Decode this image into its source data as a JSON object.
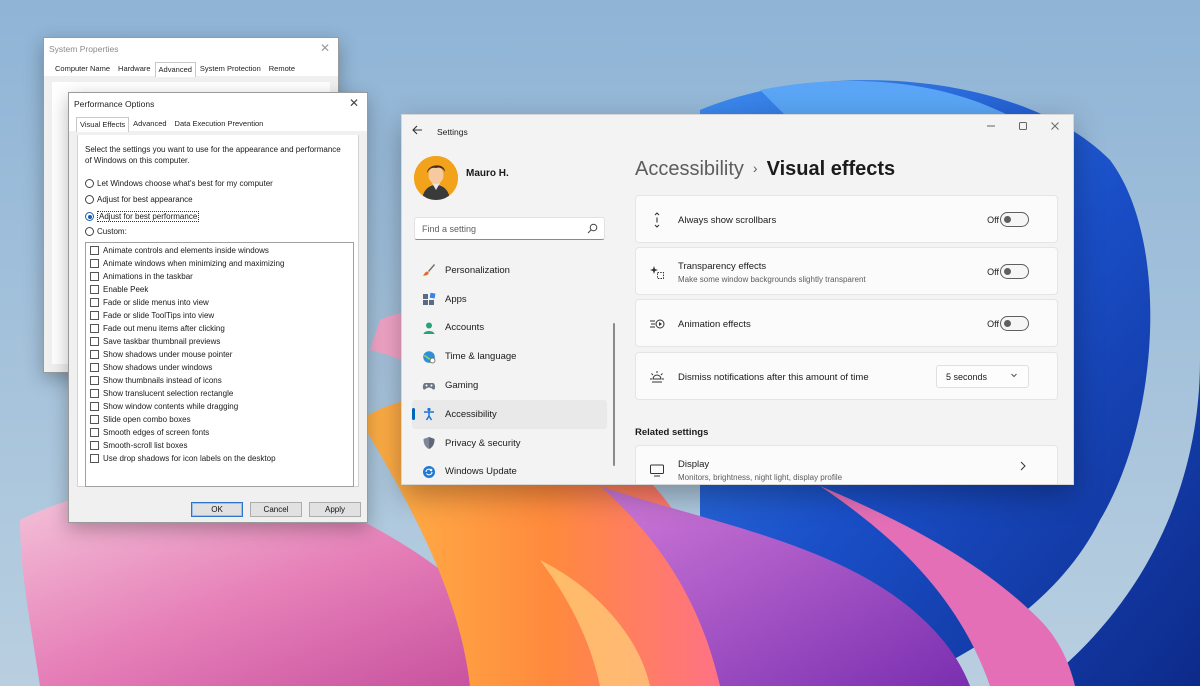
{
  "system_properties": {
    "title": "System Properties",
    "tabs": [
      "Computer Name",
      "Hardware",
      "Advanced",
      "System Protection",
      "Remote"
    ],
    "active_tab": "Advanced"
  },
  "performance_options": {
    "title": "Performance Options",
    "tabs": [
      "Visual Effects",
      "Advanced",
      "Data Execution Prevention"
    ],
    "active_tab": "Visual Effects",
    "description": "Select the settings you want to use for the appearance and performance of Windows on this computer.",
    "radios": [
      {
        "label": "Let Windows choose what's best for my computer",
        "checked": false
      },
      {
        "label": "Adjust for best appearance",
        "checked": false
      },
      {
        "label": "Adjust for best performance",
        "checked": true
      },
      {
        "label": "Custom:",
        "checked": false
      }
    ],
    "effects": [
      "Animate controls and elements inside windows",
      "Animate windows when minimizing and maximizing",
      "Animations in the taskbar",
      "Enable Peek",
      "Fade or slide menus into view",
      "Fade or slide ToolTips into view",
      "Fade out menu items after clicking",
      "Save taskbar thumbnail previews",
      "Show shadows under mouse pointer",
      "Show shadows under windows",
      "Show thumbnails instead of icons",
      "Show translucent selection rectangle",
      "Show window contents while dragging",
      "Slide open combo boxes",
      "Smooth edges of screen fonts",
      "Smooth-scroll list boxes",
      "Use drop shadows for icon labels on the desktop"
    ],
    "buttons": {
      "ok": "OK",
      "cancel": "Cancel",
      "apply": "Apply"
    }
  },
  "settings": {
    "window_title": "Settings",
    "user_name": "Mauro H.",
    "search_placeholder": "Find a setting",
    "nav": [
      {
        "label": "Personalization",
        "icon": "brush-icon",
        "active": false
      },
      {
        "label": "Apps",
        "icon": "apps-icon",
        "active": false
      },
      {
        "label": "Accounts",
        "icon": "person-icon",
        "active": false
      },
      {
        "label": "Time & language",
        "icon": "globe-clock-icon",
        "active": false
      },
      {
        "label": "Gaming",
        "icon": "gamepad-icon",
        "active": false
      },
      {
        "label": "Accessibility",
        "icon": "accessibility-icon",
        "active": true
      },
      {
        "label": "Privacy & security",
        "icon": "shield-icon",
        "active": false
      },
      {
        "label": "Windows Update",
        "icon": "update-icon",
        "active": false
      }
    ],
    "breadcrumb_parent": "Accessibility",
    "breadcrumb_separator": "›",
    "page_title": "Visual effects",
    "cards": {
      "scrollbars": {
        "label": "Always show scrollbars",
        "state": "Off",
        "icon": "scrollbar-icon"
      },
      "transparency": {
        "label": "Transparency effects",
        "sub": "Make some window backgrounds slightly transparent",
        "state": "Off",
        "icon": "sparkle-icon"
      },
      "animation": {
        "label": "Animation effects",
        "state": "Off",
        "icon": "animation-icon"
      },
      "notifications": {
        "label": "Dismiss notifications after this amount of time",
        "value": "5 seconds",
        "icon": "sun-icon"
      }
    },
    "related_heading": "Related settings",
    "display": {
      "label": "Display",
      "sub": "Monitors, brightness, night light, display profile",
      "icon": "monitor-icon"
    },
    "colors": {
      "accent": "#0067c0",
      "avatar_bg": "#f2a21b"
    }
  }
}
